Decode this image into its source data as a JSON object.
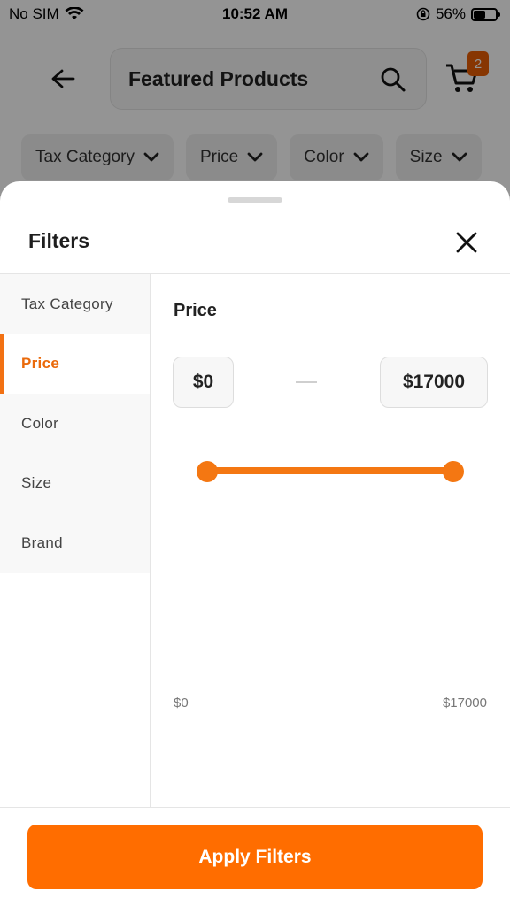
{
  "status_bar": {
    "carrier": "No SIM",
    "time": "10:52 AM",
    "battery": "56%",
    "battery_level": 0.56
  },
  "header": {
    "search_text": "Featured Products",
    "cart_count": "2"
  },
  "chips": [
    {
      "label": "Tax Category"
    },
    {
      "label": "Price"
    },
    {
      "label": "Color"
    },
    {
      "label": "Size"
    }
  ],
  "filters": {
    "title": "Filters",
    "categories": [
      {
        "label": "Tax Category",
        "active": false
      },
      {
        "label": "Price",
        "active": true
      },
      {
        "label": "Color",
        "active": false
      },
      {
        "label": "Size",
        "active": false
      },
      {
        "label": "Brand",
        "active": false
      }
    ],
    "price": {
      "title": "Price",
      "min_value": "$0",
      "max_value": "$17000",
      "range_min_label": "$0",
      "range_max_label": "$17000"
    },
    "apply_label": "Apply Filters"
  },
  "colors": {
    "accent": "#f47712",
    "button": "#ff6d00",
    "active_text": "#ea6a0b"
  }
}
